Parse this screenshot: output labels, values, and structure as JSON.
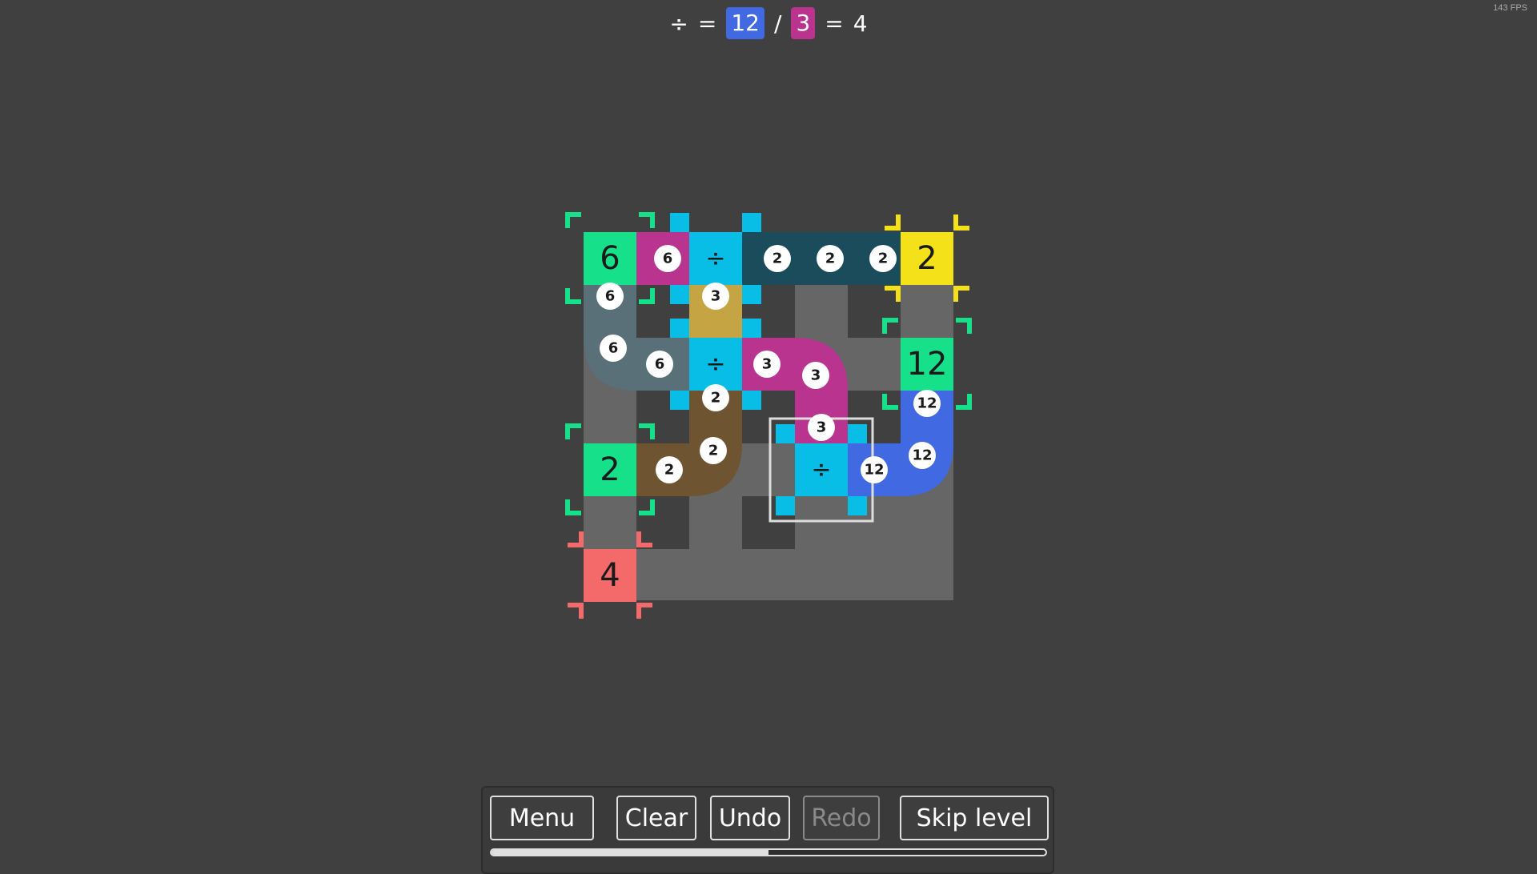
{
  "fps_text": "143 FPS",
  "equation": {
    "operator": "÷",
    "equals": "=",
    "left_value": "12",
    "slash": "/",
    "right_value": "3",
    "equals2": "=",
    "result": "4",
    "left_color": "#4169e1",
    "right_color": "#b8348f"
  },
  "palette": {
    "green": "#17e08a",
    "yellow": "#f5e11a",
    "salmon": "#f46a6a",
    "cyan": "#08bde6",
    "blue": "#4169e1",
    "magenta": "#b8348f",
    "gold": "#c4a443",
    "brown": "#6e5430",
    "slate": "#5a7078",
    "teal_dark": "#1b4c5c",
    "track": "#666666"
  },
  "nodes": [
    {
      "id": "node-6-top",
      "value": "6",
      "color": "green"
    },
    {
      "id": "node-2-top",
      "value": "2",
      "color": "yellow"
    },
    {
      "id": "node-12-right",
      "value": "12",
      "color": "green"
    },
    {
      "id": "node-2-left",
      "value": "2",
      "color": "green"
    },
    {
      "id": "node-4-bottom",
      "value": "4",
      "color": "salmon"
    }
  ],
  "operators": [
    {
      "id": "op-top",
      "symbol": "÷"
    },
    {
      "id": "op-middle",
      "symbol": "÷"
    },
    {
      "id": "op-selected",
      "symbol": "÷"
    }
  ],
  "badges": {
    "top_row": [
      "6",
      "2",
      "2",
      "2"
    ],
    "left_column": [
      "6",
      "6",
      "6"
    ],
    "gold_column": [
      "3"
    ],
    "magenta_path": [
      "3",
      "3",
      "3"
    ],
    "brown_path": [
      "2",
      "2",
      "2"
    ],
    "blue_path": [
      "12",
      "12",
      "12"
    ]
  },
  "toolbar": {
    "menu_label": "Menu",
    "clear_label": "Clear",
    "undo_label": "Undo",
    "redo_label": "Redo",
    "skip_label": "Skip level",
    "redo_enabled": false,
    "progress_fraction": 0.5
  }
}
